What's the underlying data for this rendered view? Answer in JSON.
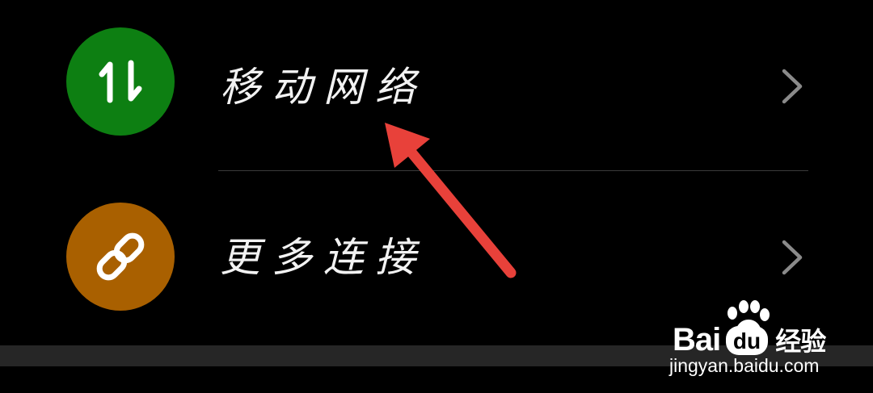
{
  "settings_list": {
    "items": [
      {
        "label": "移动网络",
        "icon": "up-down-arrows-icon",
        "icon_bg": "#0d7f12",
        "chevron": "chevron-right-icon"
      },
      {
        "label": "更多连接",
        "icon": "link-icon",
        "icon_bg": "#a96000",
        "chevron": "chevron-right-icon"
      }
    ]
  },
  "annotation": {
    "arrow_color": "#e8413a"
  },
  "watermark": {
    "brand_left": "Bai",
    "brand_right": "经验",
    "url": "jingyan.baidu.com"
  },
  "colors": {
    "background": "#000000",
    "text": "#f2f2f2",
    "chevron": "#8a8a8a",
    "divider": "#3a3a3a",
    "bottom_bar": "#262626"
  }
}
